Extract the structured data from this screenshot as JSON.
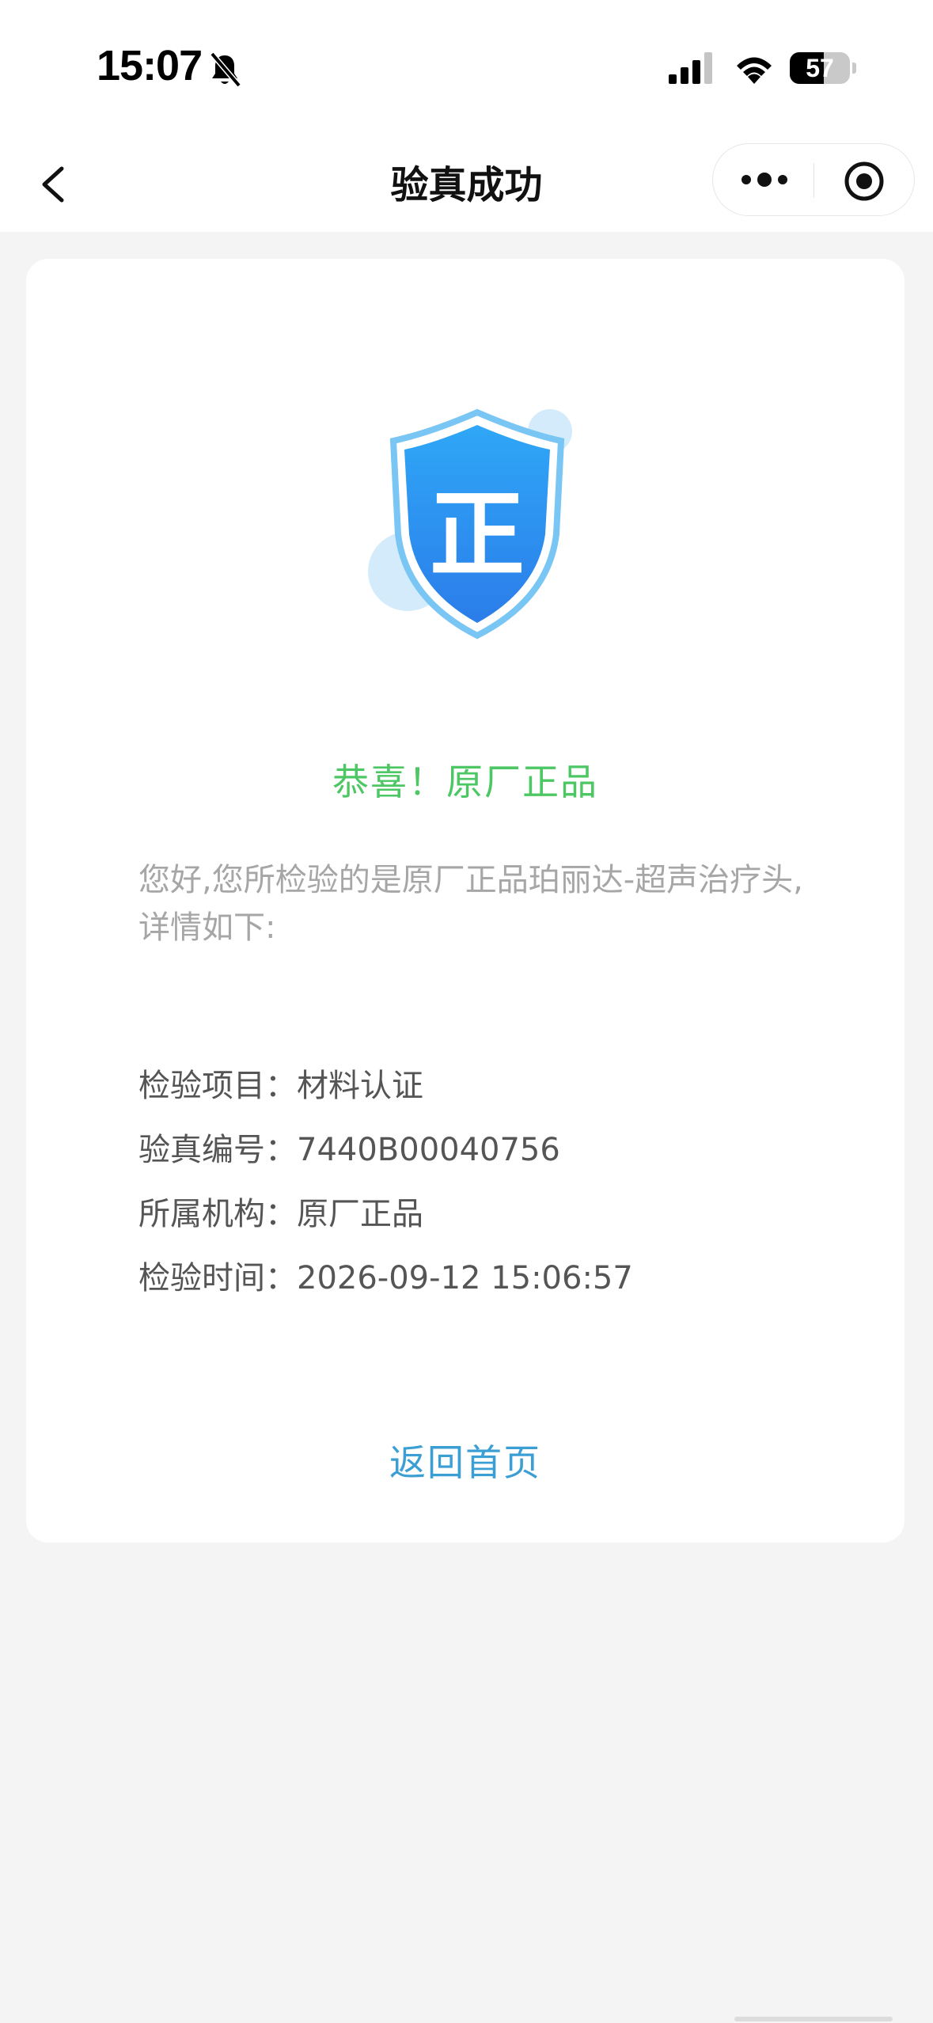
{
  "status_bar": {
    "time": "15:07",
    "battery_text": "57",
    "battery_level": 0.57
  },
  "nav": {
    "title": "验真成功"
  },
  "result": {
    "badge_char": "正",
    "congrats": "恭喜！原厂正品",
    "intro": "您好,您所检验的是原厂正品珀丽达-超声治疗头,详情如下:"
  },
  "details": [
    {
      "label": "检验项目：",
      "value": "材料认证"
    },
    {
      "label": "验真编号：",
      "value": "7440B00040756"
    },
    {
      "label": "所属机构：",
      "value": "原厂正品"
    },
    {
      "label": "检验时间：",
      "value": "2026-09-12 15:06:57"
    }
  ],
  "actions": {
    "home_label": "返回首页"
  },
  "colors": {
    "success_green": "#4cc764",
    "link_blue": "#3c9fd4",
    "shield_blue": "#2f8cf0",
    "page_bg": "#f4f4f4"
  }
}
